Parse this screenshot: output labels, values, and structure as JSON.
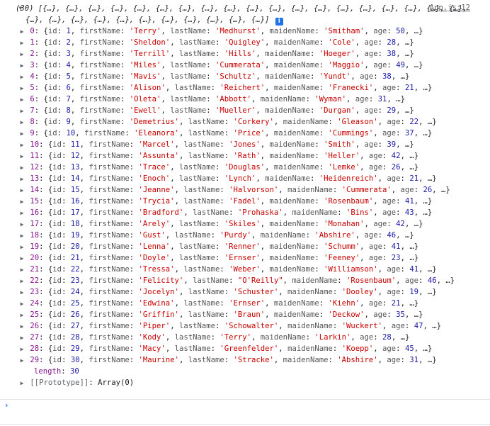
{
  "source_link": "App.js:12",
  "summary": {
    "line1": "(30) [{…}, {…}, {…}, {…}, {…}, {…}, {…}, {…}, {…}, {…}, {…}, {…}, {…}, {…}, {…}, {…}, {…}, {…}, {…},",
    "line2": "{…}, {…}, {…}, {…}, {…}, {…}, {…}, {…}, {…}, {…}, {…}]"
  },
  "info_badge": "i",
  "rows": [
    {
      "index": "0",
      "id": "1",
      "firstName": "'Terry'",
      "lastName": "'Medhurst'",
      "maidenName": "'Smitham'",
      "age": "50"
    },
    {
      "index": "1",
      "id": "2",
      "firstName": "'Sheldon'",
      "lastName": "'Quigley'",
      "maidenName": "'Cole'",
      "age": "28"
    },
    {
      "index": "2",
      "id": "3",
      "firstName": "'Terrill'",
      "lastName": "'Hills'",
      "maidenName": "'Hoeger'",
      "age": "38"
    },
    {
      "index": "3",
      "id": "4",
      "firstName": "'Miles'",
      "lastName": "'Cummerata'",
      "maidenName": "'Maggio'",
      "age": "49"
    },
    {
      "index": "4",
      "id": "5",
      "firstName": "'Mavis'",
      "lastName": "'Schultz'",
      "maidenName": "'Yundt'",
      "age": "38"
    },
    {
      "index": "5",
      "id": "6",
      "firstName": "'Alison'",
      "lastName": "'Reichert'",
      "maidenName": "'Franecki'",
      "age": "21"
    },
    {
      "index": "6",
      "id": "7",
      "firstName": "'Oleta'",
      "lastName": "'Abbott'",
      "maidenName": "'Wyman'",
      "age": "31"
    },
    {
      "index": "7",
      "id": "8",
      "firstName": "'Ewell'",
      "lastName": "'Mueller'",
      "maidenName": "'Durgan'",
      "age": "29"
    },
    {
      "index": "8",
      "id": "9",
      "firstName": "'Demetrius'",
      "lastName": "'Corkery'",
      "maidenName": "'Gleason'",
      "age": "22"
    },
    {
      "index": "9",
      "id": "10",
      "firstName": "'Eleanora'",
      "lastName": "'Price'",
      "maidenName": "'Cummings'",
      "age": "37"
    },
    {
      "index": "10",
      "id": "11",
      "firstName": "'Marcel'",
      "lastName": "'Jones'",
      "maidenName": "'Smith'",
      "age": "39"
    },
    {
      "index": "11",
      "id": "12",
      "firstName": "'Assunta'",
      "lastName": "'Rath'",
      "maidenName": "'Heller'",
      "age": "42"
    },
    {
      "index": "12",
      "id": "13",
      "firstName": "'Trace'",
      "lastName": "'Douglas'",
      "maidenName": "'Lemke'",
      "age": "26"
    },
    {
      "index": "13",
      "id": "14",
      "firstName": "'Enoch'",
      "lastName": "'Lynch'",
      "maidenName": "'Heidenreich'",
      "age": "21"
    },
    {
      "index": "14",
      "id": "15",
      "firstName": "'Jeanne'",
      "lastName": "'Halvorson'",
      "maidenName": "'Cummerata'",
      "age": "26"
    },
    {
      "index": "15",
      "id": "16",
      "firstName": "'Trycia'",
      "lastName": "'Fadel'",
      "maidenName": "'Rosenbaum'",
      "age": "41"
    },
    {
      "index": "16",
      "id": "17",
      "firstName": "'Bradford'",
      "lastName": "'Prohaska'",
      "maidenName": "'Bins'",
      "age": "43"
    },
    {
      "index": "17",
      "id": "18",
      "firstName": "'Arely'",
      "lastName": "'Skiles'",
      "maidenName": "'Monahan'",
      "age": "42"
    },
    {
      "index": "18",
      "id": "19",
      "firstName": "'Gust'",
      "lastName": "'Purdy'",
      "maidenName": "'Abshire'",
      "age": "46"
    },
    {
      "index": "19",
      "id": "20",
      "firstName": "'Lenna'",
      "lastName": "'Renner'",
      "maidenName": "'Schumm'",
      "age": "41"
    },
    {
      "index": "20",
      "id": "21",
      "firstName": "'Doyle'",
      "lastName": "'Ernser'",
      "maidenName": "'Feeney'",
      "age": "23"
    },
    {
      "index": "21",
      "id": "22",
      "firstName": "'Tressa'",
      "lastName": "'Weber'",
      "maidenName": "'Williamson'",
      "age": "41"
    },
    {
      "index": "22",
      "id": "23",
      "firstName": "'Felicity'",
      "lastName": "\"O'Reilly\"",
      "maidenName": "'Rosenbaum'",
      "age": "46"
    },
    {
      "index": "23",
      "id": "24",
      "firstName": "'Jocelyn'",
      "lastName": "'Schuster'",
      "maidenName": "'Dooley'",
      "age": "19"
    },
    {
      "index": "24",
      "id": "25",
      "firstName": "'Edwina'",
      "lastName": "'Ernser'",
      "maidenName": "'Kiehn'",
      "age": "21"
    },
    {
      "index": "25",
      "id": "26",
      "firstName": "'Griffin'",
      "lastName": "'Braun'",
      "maidenName": "'Deckow'",
      "age": "35"
    },
    {
      "index": "26",
      "id": "27",
      "firstName": "'Piper'",
      "lastName": "'Schowalter'",
      "maidenName": "'Wuckert'",
      "age": "47"
    },
    {
      "index": "27",
      "id": "28",
      "firstName": "'Kody'",
      "lastName": "'Terry'",
      "maidenName": "'Larkin'",
      "age": "28"
    },
    {
      "index": "28",
      "id": "29",
      "firstName": "'Macy'",
      "lastName": "'Greenfelder'",
      "maidenName": "'Koepp'",
      "age": "45"
    },
    {
      "index": "29",
      "id": "30",
      "firstName": "'Maurine'",
      "lastName": "'Stracke'",
      "maidenName": "'Abshire'",
      "age": "31"
    }
  ],
  "length": {
    "key": "length",
    "value": "30"
  },
  "prototype": {
    "key": "[[Prototype]]",
    "value": "Array(0)"
  },
  "prompt_symbol": "›",
  "colors": {
    "index": "#881391",
    "string": "#c80000",
    "number": "#1a1aa6",
    "link": "#1a73e8"
  }
}
